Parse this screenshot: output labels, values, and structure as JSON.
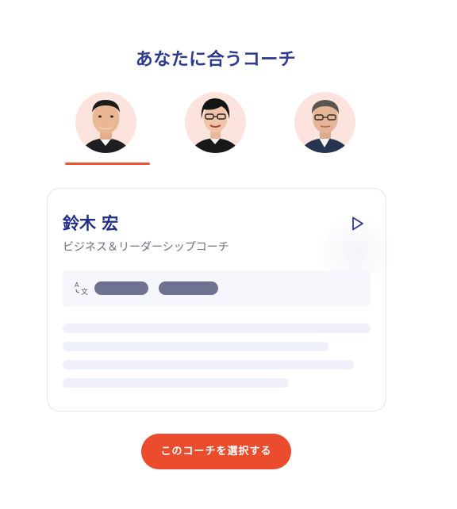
{
  "header": {
    "title": "あなたに合うコーチ"
  },
  "coaches": [
    {
      "icon": "coach-avatar-1",
      "selected": true
    },
    {
      "icon": "coach-avatar-2",
      "selected": false
    },
    {
      "icon": "coach-avatar-3",
      "selected": false
    }
  ],
  "card": {
    "name": "鈴木 宏",
    "role": "ビジネス＆リーダーシップコーチ",
    "play_icon": "play-icon",
    "language_icon": "translate-icon"
  },
  "select_button": {
    "label": "このコーチを選択する"
  },
  "colors": {
    "title": "#2b3990",
    "accent": "#ea4c2d",
    "avatar_bg": "#fde3dd",
    "pill": "#6e7190",
    "skeleton": "#eef1f9"
  }
}
